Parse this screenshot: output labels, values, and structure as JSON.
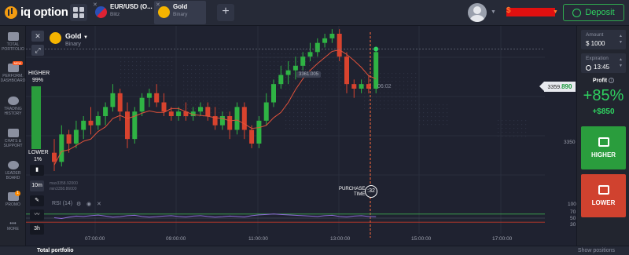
{
  "app": {
    "logo_text": "iq option"
  },
  "tabs": [
    {
      "title": "EUR/USD (O...",
      "subtitle": "Blitz"
    },
    {
      "title": "Gold",
      "subtitle": "Binary"
    }
  ],
  "header": {
    "balance_currency": "$",
    "deposit_label": "Deposit"
  },
  "sidebar": {
    "items": [
      {
        "label": "TOTAL PORTFOLIO",
        "icon": "briefcase-icon"
      },
      {
        "label": "PERFORM. DASHBOARD",
        "icon": "dashboard-icon",
        "badge": "NEW"
      },
      {
        "label": "TRADING HISTORY",
        "icon": "history-icon"
      },
      {
        "label": "CHATS & SUPPORT",
        "icon": "chat-icon"
      },
      {
        "label": "LEADER BOARD",
        "icon": "trophy-icon"
      },
      {
        "label": "PROMO",
        "icon": "gift-icon",
        "badge": "1"
      },
      {
        "label": "MORE",
        "icon": "more-icon"
      }
    ]
  },
  "chart": {
    "asset_name": "Gold",
    "asset_type": "Binary",
    "higher_label": "HIGHER",
    "higher_pct": "99%",
    "lower_label": "LOWER",
    "lower_pct": "1%",
    "timeframe": "10m",
    "expiry_short": "3h",
    "rsi_label": "RSI (14)",
    "hi_value": "max3358.92000",
    "lo_value": "min3358.86000",
    "marker_price": "3361.005",
    "current_time": "06:02",
    "purchase_label_1": "PURCHASE",
    "purchase_label_2": "TIME",
    "timer": ":32",
    "current_price_prefix": "3359.",
    "current_price_suffix": "890",
    "price_axis_label": "3350",
    "rsi_axis": [
      "100",
      "70",
      "50",
      "30"
    ],
    "time_axis": [
      "07:00:00",
      "09:00:00",
      "11:00:00",
      "13:00:00",
      "15:00:00",
      "17:00:00"
    ]
  },
  "chart_data": {
    "type": "candlestick",
    "ylim": [
      3338,
      3368
    ],
    "candles": [
      [
        3342,
        3340,
        3345,
        3338
      ],
      [
        3340,
        3346,
        3348,
        3339
      ],
      [
        3346,
        3344,
        3347,
        3342
      ],
      [
        3344,
        3347,
        3349,
        3343
      ],
      [
        3347,
        3349,
        3350,
        3345
      ],
      [
        3349,
        3348,
        3352,
        3346
      ],
      [
        3348,
        3350,
        3351,
        3347
      ],
      [
        3350,
        3352,
        3353,
        3348
      ],
      [
        3352,
        3355,
        3357,
        3351
      ],
      [
        3355,
        3351,
        3356,
        3349
      ],
      [
        3351,
        3345,
        3353,
        3343
      ],
      [
        3345,
        3351,
        3352,
        3344
      ],
      [
        3351,
        3354,
        3355,
        3350
      ],
      [
        3354,
        3355,
        3356,
        3352
      ],
      [
        3355,
        3353,
        3357,
        3352
      ],
      [
        3353,
        3351,
        3355,
        3350
      ],
      [
        3351,
        3350,
        3352,
        3349
      ],
      [
        3350,
        3351,
        3352,
        3349
      ],
      [
        3351,
        3350,
        3353,
        3349
      ],
      [
        3350,
        3351,
        3352,
        3349
      ],
      [
        3351,
        3352,
        3353,
        3350
      ],
      [
        3352,
        3350,
        3353,
        3349
      ],
      [
        3350,
        3348,
        3352,
        3347
      ],
      [
        3348,
        3350,
        3351,
        3347
      ],
      [
        3350,
        3347,
        3351,
        3345
      ],
      [
        3347,
        3352,
        3353,
        3346
      ],
      [
        3352,
        3347,
        3353,
        3345
      ],
      [
        3347,
        3344,
        3348,
        3343
      ],
      [
        3344,
        3349,
        3350,
        3343
      ],
      [
        3349,
        3353,
        3355,
        3348
      ],
      [
        3353,
        3357,
        3358,
        3352
      ],
      [
        3357,
        3359,
        3361,
        3356
      ],
      [
        3359,
        3360,
        3362,
        3357
      ],
      [
        3360,
        3361,
        3363,
        3358
      ],
      [
        3361,
        3363,
        3364,
        3360
      ],
      [
        3363,
        3364,
        3366,
        3362
      ],
      [
        3364,
        3366,
        3367,
        3363
      ],
      [
        3366,
        3367,
        3368,
        3365
      ],
      [
        3367,
        3368,
        3369,
        3366
      ],
      [
        3368,
        3363,
        3369,
        3362
      ],
      [
        3363,
        3357,
        3364,
        3355
      ],
      [
        3357,
        3356,
        3358,
        3354
      ],
      [
        3356,
        3357,
        3358,
        3355
      ],
      [
        3357,
        3356,
        3359,
        3355
      ],
      [
        3356,
        3364,
        3365,
        3355
      ]
    ],
    "rsi": [
      52,
      48,
      55,
      60,
      58,
      62,
      65,
      60,
      55,
      57,
      62,
      64,
      58,
      55,
      57,
      60,
      62,
      58,
      56,
      60,
      62,
      58,
      55,
      57,
      60,
      58,
      56,
      62,
      66,
      68,
      70,
      68,
      66,
      64,
      62,
      60,
      58,
      62,
      64,
      58,
      56,
      60,
      62,
      58,
      57
    ]
  },
  "trade": {
    "amount_label": "Amount",
    "amount_value": "$ 1000",
    "expiration_label": "Expiration",
    "expiration_value": "13:45",
    "profit_label": "Profit",
    "profit_pct": "+85%",
    "profit_amount": "+$850",
    "higher_button": "HIGHER",
    "lower_button": "LOWER"
  },
  "bottom": {
    "left_label": "Total portfolio",
    "right_label": "Show positions"
  },
  "colors": {
    "up": "#2fb344",
    "down": "#d8432e",
    "accent_green": "#2fd160"
  }
}
